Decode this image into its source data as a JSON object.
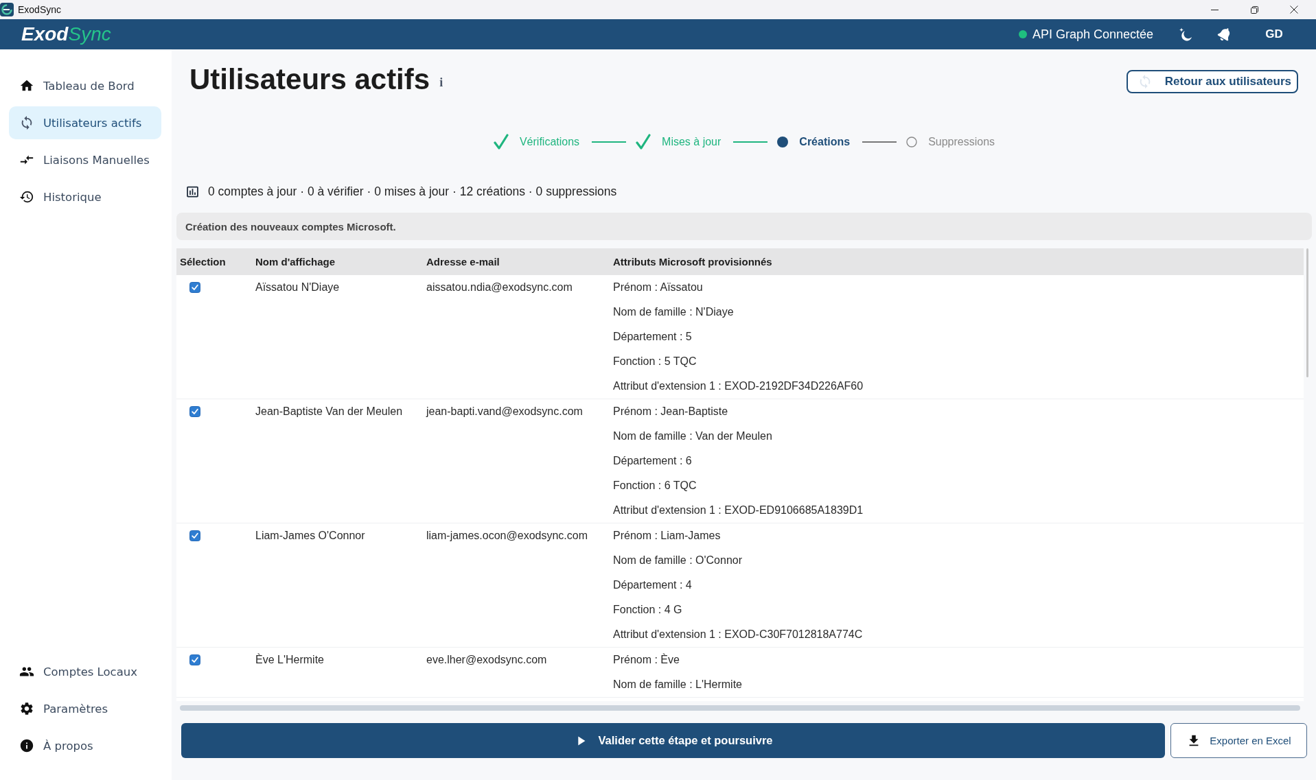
{
  "window": {
    "title": "ExodSync"
  },
  "header": {
    "logo": {
      "strong": "Exod",
      "light": "Sync"
    },
    "api_status": {
      "label": "API Graph Connectée",
      "connected": true
    },
    "user": {
      "initials": "GD"
    }
  },
  "sidebar": {
    "items": [
      {
        "label": "Tableau de Bord",
        "selected": false
      },
      {
        "label": "Utilisateurs actifs",
        "selected": true
      },
      {
        "label": "Liaisons Manuelles",
        "selected": false
      },
      {
        "label": "Historique",
        "selected": false
      }
    ],
    "footer_items": [
      {
        "label": "Comptes Locaux",
        "selected": false
      },
      {
        "label": "Paramètres",
        "selected": false
      },
      {
        "label": "À propos",
        "selected": false
      }
    ]
  },
  "page": {
    "title": "Utilisateurs actifs",
    "info_mark": "i",
    "back_button": {
      "label": "Retour aux utilisateurs"
    }
  },
  "stepper": {
    "steps": [
      {
        "label": "Vérifications",
        "completed": true,
        "current": false
      },
      {
        "label": "Mises à jour",
        "completed": true,
        "current": false
      },
      {
        "label": "Créations",
        "completed": false,
        "current": true
      },
      {
        "label": "Suppressions",
        "completed": false,
        "current": false
      }
    ]
  },
  "summary": {
    "text": "0 comptes à jour · 0 à vérifier · 0 mises à jour · 12 créations · 0 suppressions"
  },
  "banner": {
    "text": "Création des nouveaux comptes Microsoft."
  },
  "table": {
    "columns": [
      "Sélection",
      "Nom d'affichage",
      "Adresse e-mail",
      "Attributs Microsoft provisionnés"
    ],
    "rows": [
      {
        "checked": true,
        "display_name": "Aïssatou N'Diaye",
        "email": "aissatou.ndia@exodsync.com",
        "attributes": [
          "Prénom : Aïssatou",
          "Nom de famille : N'Diaye",
          "Département : 5",
          "Fonction : 5 TQC",
          "Attribut d'extension 1 : EXOD-2192DF34D226AF60"
        ]
      },
      {
        "checked": true,
        "display_name": "Jean-Baptiste Van der Meulen",
        "email": "jean-bapti.vand@exodsync.com",
        "attributes": [
          "Prénom : Jean-Baptiste",
          "Nom de famille : Van der Meulen",
          "Département : 6",
          "Fonction : 6 TQC",
          "Attribut d'extension 1 : EXOD-ED9106685A1839D1"
        ]
      },
      {
        "checked": true,
        "display_name": "Liam-James O'Connor",
        "email": "liam-james.ocon@exodsync.com",
        "attributes": [
          "Prénom : Liam-James",
          "Nom de famille : O'Connor",
          "Département : 4",
          "Fonction : 4 G",
          "Attribut d'extension 1 : EXOD-C30F7012818A774C"
        ]
      },
      {
        "checked": true,
        "display_name": "Ève L'Hermite",
        "email": "eve.lher@exodsync.com",
        "attributes": [
          "Prénom : Ève",
          "Nom de famille : L'Hermite"
        ]
      }
    ]
  },
  "actions": {
    "validate_button": {
      "label": "Valider cette étape et poursuivre"
    },
    "export_button": {
      "label": "Exporter en Excel"
    }
  }
}
